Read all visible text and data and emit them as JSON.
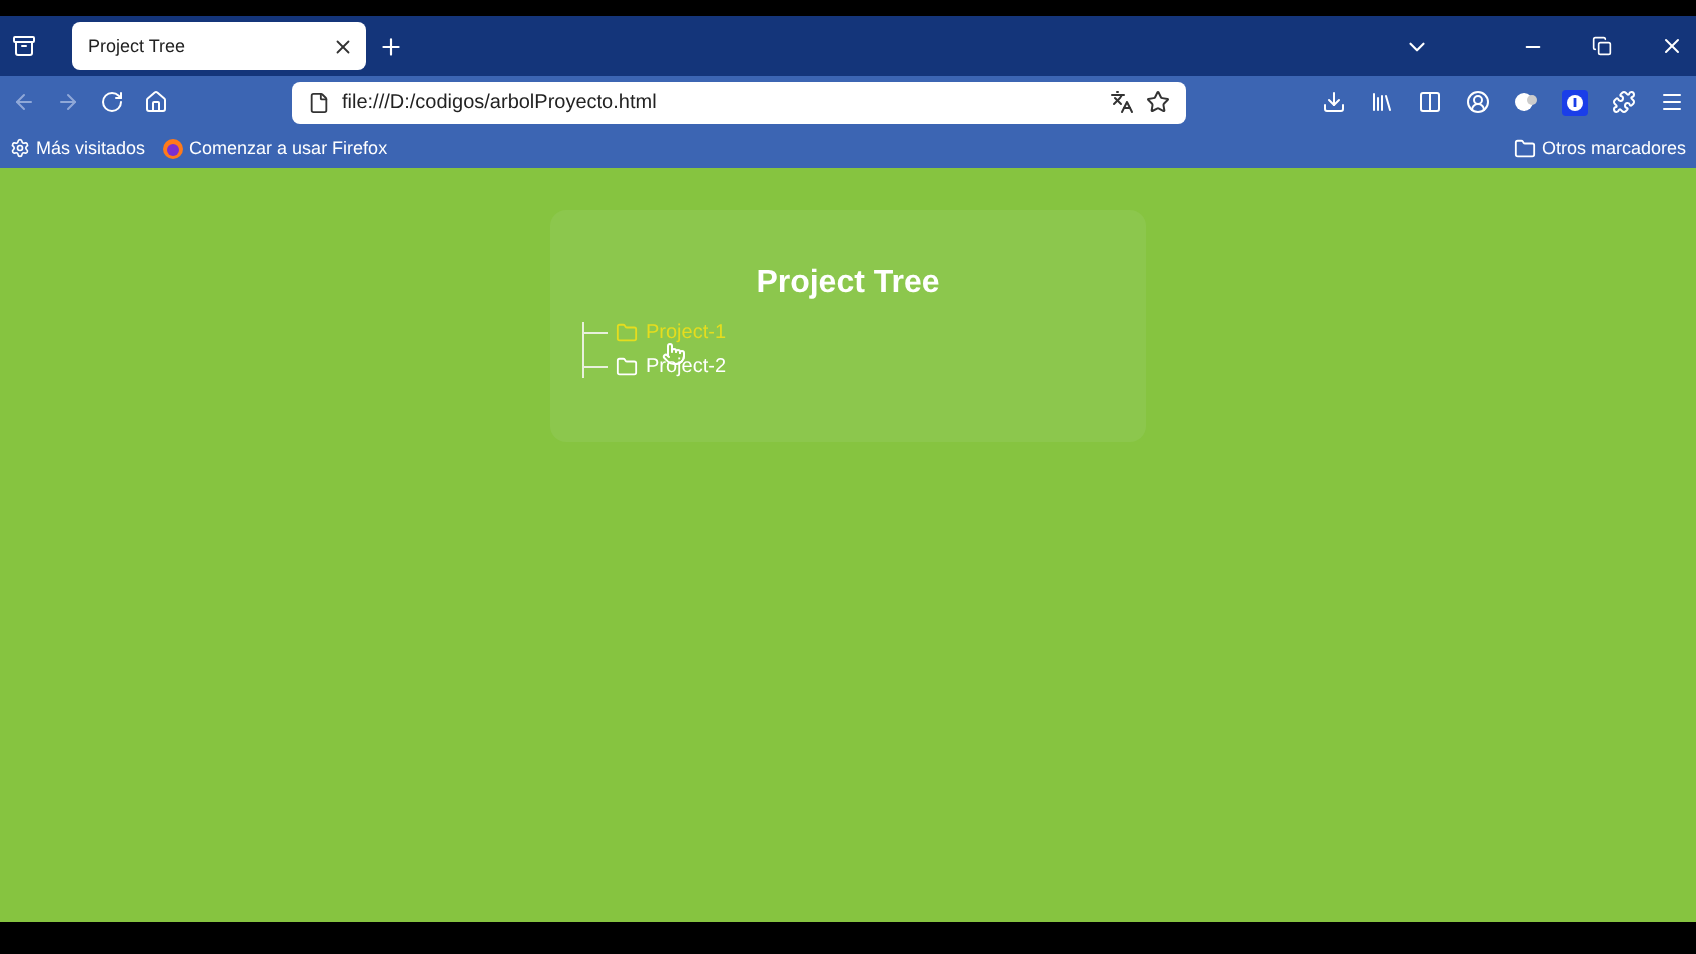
{
  "tabs": [
    {
      "title": "Project Tree",
      "selected": true
    }
  ],
  "address": {
    "url": "file:///D:/codigos/arbolProyecto.html"
  },
  "bookmarks": [
    {
      "label": "Más visitados",
      "kind": "gear"
    },
    {
      "label": "Comenzar a usar Firefox",
      "kind": "firefox"
    }
  ],
  "other_bookmarks": "Otros marcadores",
  "page": {
    "heading": "Project Tree",
    "items": [
      {
        "name": "Project-1",
        "hovered": true
      },
      {
        "name": "Project-2",
        "hovered": false
      }
    ]
  }
}
